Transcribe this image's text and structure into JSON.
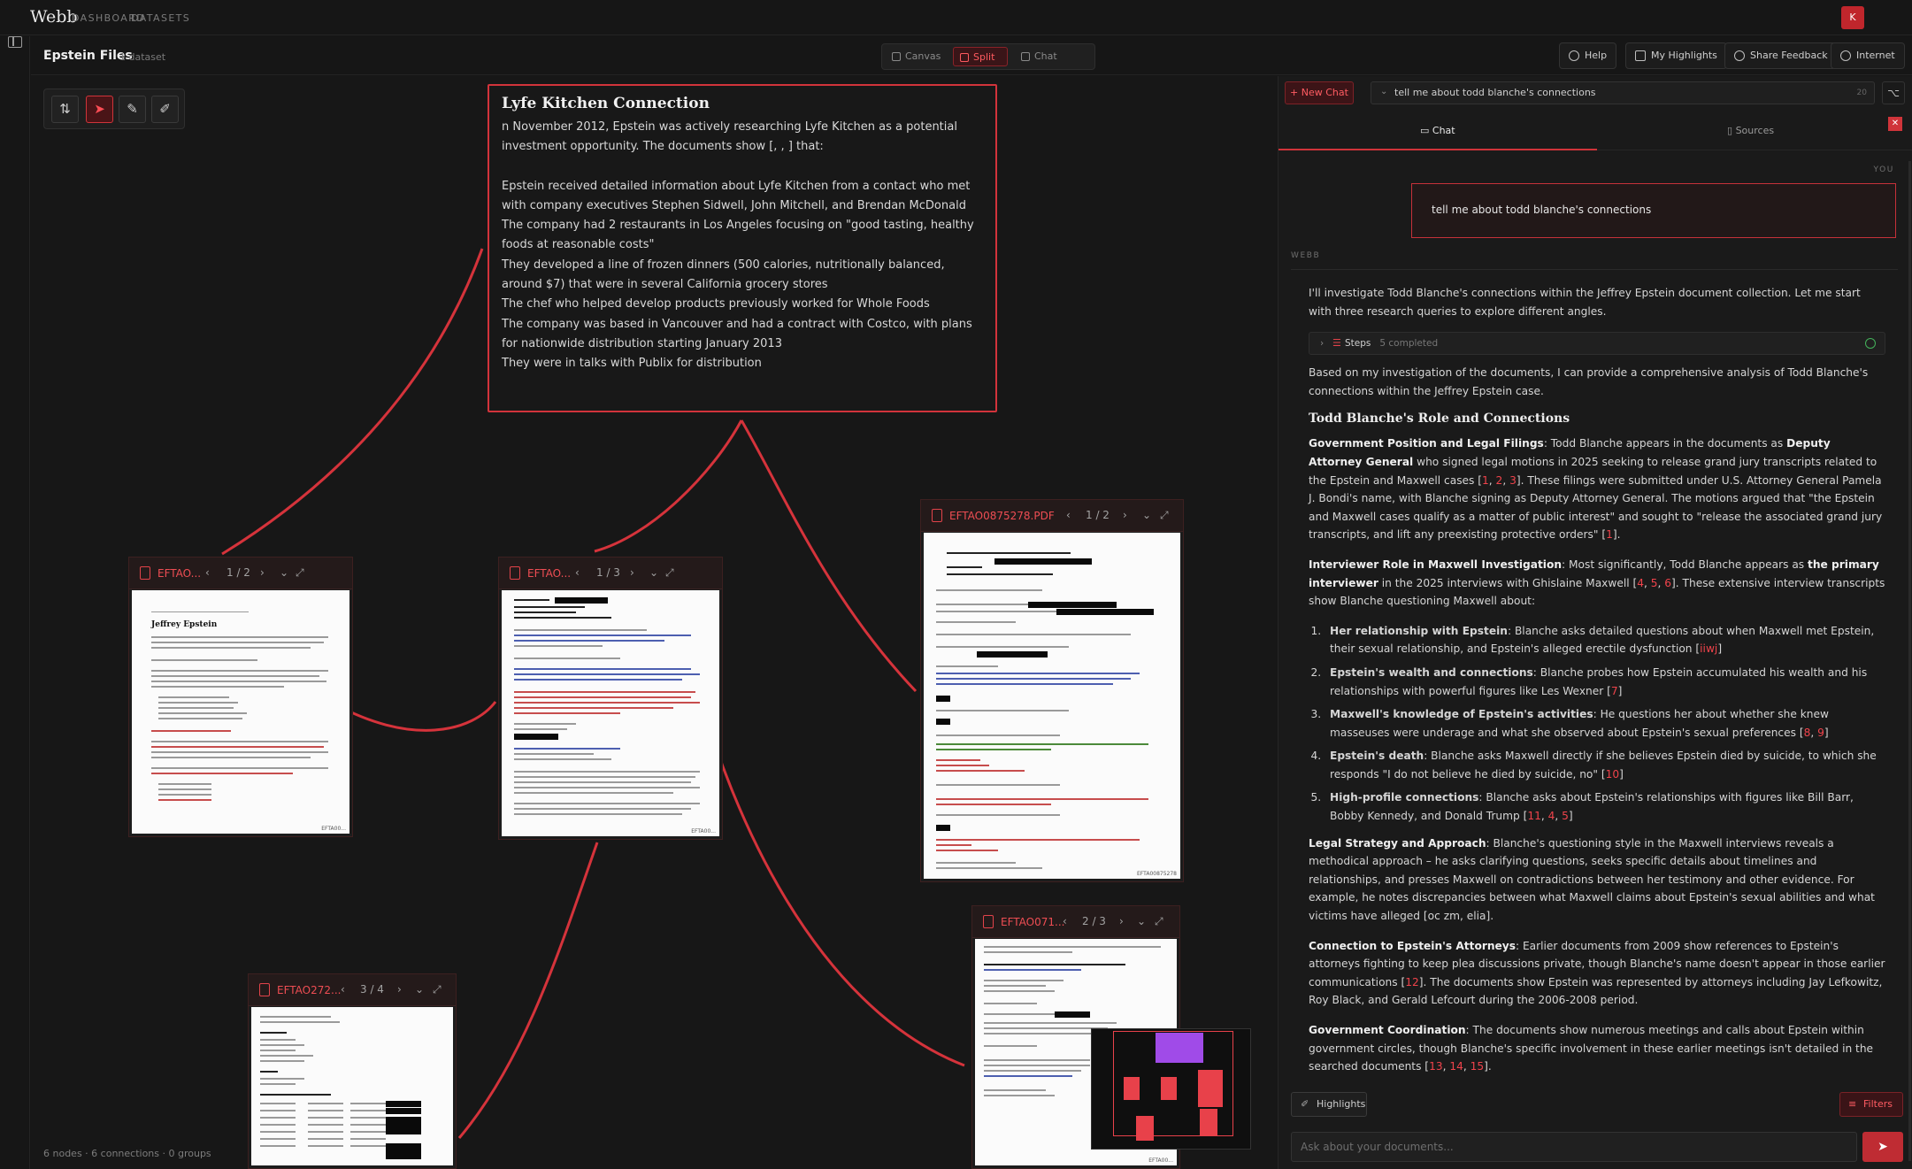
{
  "app": {
    "logo": "Webb",
    "nav": [
      "DASHBOARD",
      "DATASETS"
    ],
    "avatar": "K"
  },
  "header": {
    "title": "Epstein Files",
    "dataset_count": "1 dataset",
    "modes": [
      "Canvas",
      "Split",
      "Chat"
    ],
    "active_mode": "Split",
    "buttons": {
      "help": "Help",
      "highlights": "My Highlights",
      "feedback": "Share Feedback",
      "internet": "Internet"
    }
  },
  "canvas": {
    "status": "6 nodes · 6 connections · 0 groups",
    "note": {
      "title": "Lyfe Kitchen Connection",
      "lines": [
        "n November 2012, Epstein was actively researching Lyfe Kitchen as a potential investment opportunity. The documents show [, , ] that:",
        "",
        "Epstein received detailed information about Lyfe Kitchen from a contact who met with company executives Stephen Sidwell, John Mitchell, and Brendan McDonald",
        "The company had 2 restaurants in Los Angeles focusing on \"good tasting, healthy foods at reasonable costs\"",
        "They developed a line of frozen dinners (500 calories, nutritionally balanced, around $7) that were in several California grocery stores",
        "The chef who helped develop products previously worked for Whole Foods",
        "The company was based in Vancouver and had a contract with Costco, with plans for nationwide distribution starting January 2013",
        "They were in talks with Publix for distribution"
      ]
    },
    "docs": [
      {
        "name": "EFTAO...",
        "page": "1 / 2",
        "page_title": "Jeffrey Epstein"
      },
      {
        "name": "EFTAO...",
        "page": "1 / 3"
      },
      {
        "name": "EFTAO0875278.PDF",
        "page": "1 / 2"
      },
      {
        "name": "EFTAO071...",
        "page": "2 / 3"
      },
      {
        "name": "EFTAO272...",
        "page": "3 / 4"
      }
    ]
  },
  "chat": {
    "new_chat": "New Chat",
    "conversation": "tell me about todd blanche's connections",
    "conversation_count": "20",
    "tabs": [
      "Chat",
      "Sources"
    ],
    "you_label": "YOU",
    "user_message": "tell me about todd blanche's connections",
    "assistant_label": "WEBB",
    "intro": "I'll investigate Todd Blanche's connections within the Jeffrey Epstein document collection. Let me start with three research queries to explore different angles.",
    "steps": {
      "label": "Steps",
      "count": "5 completed"
    },
    "summary": "Based on my investigation of the documents, I can provide a comprehensive analysis of Todd Blanche's connections within the Jeffrey Epstein case.",
    "section_title": "Todd Blanche's Role and Connections",
    "highlights_btn": "Highlights",
    "filters_btn": "Filters",
    "input_placeholder": "Ask about your documents..."
  }
}
